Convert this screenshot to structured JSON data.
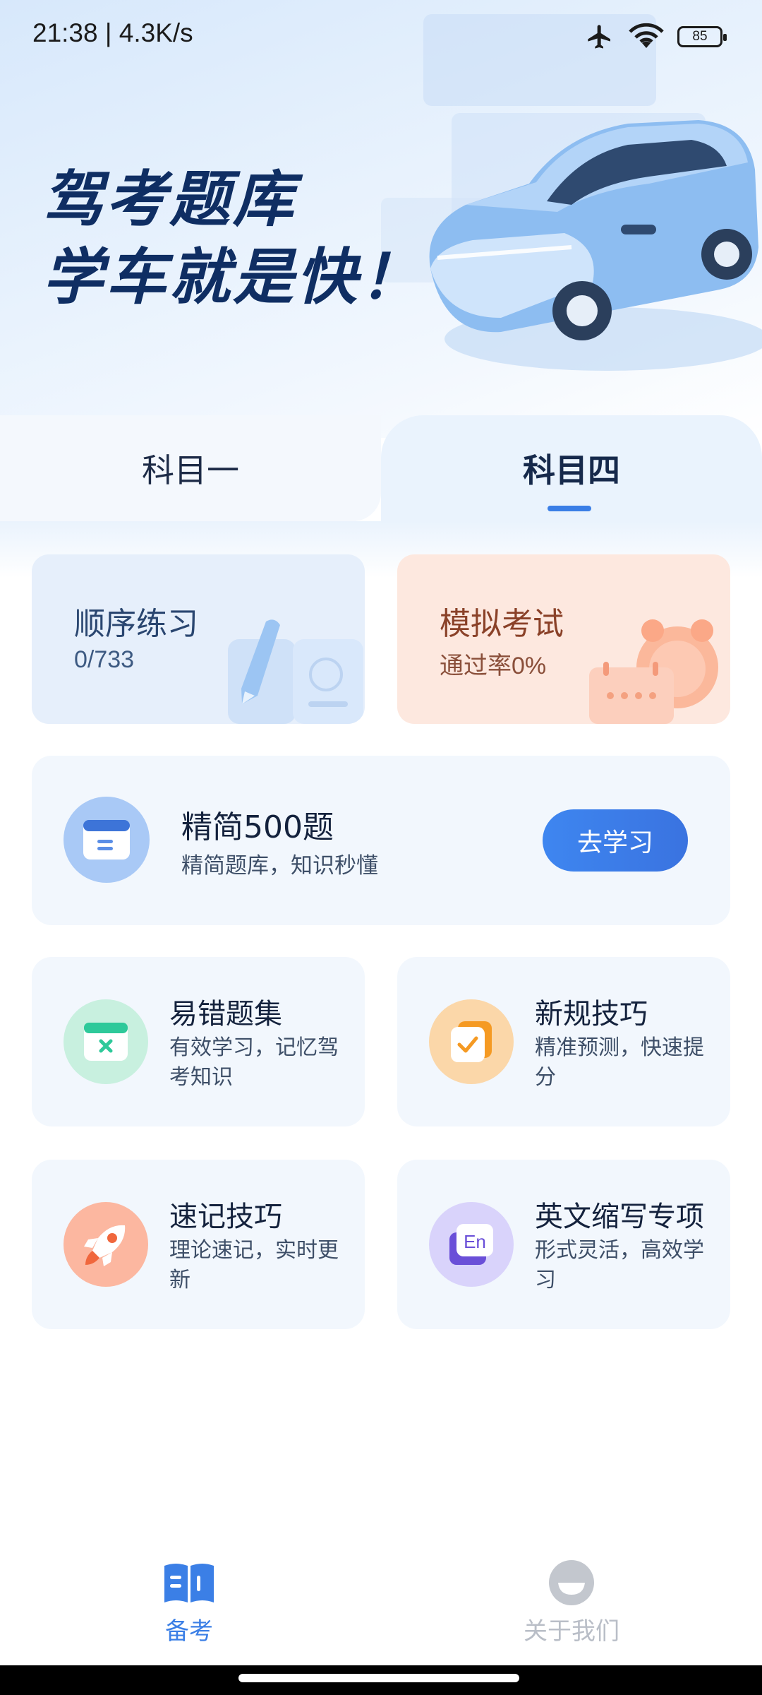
{
  "status_bar": {
    "time": "21:38 | 4.3K/s",
    "battery": "85"
  },
  "hero": {
    "title_line1": "驾考题库",
    "title_line2": "学车就是快！"
  },
  "tabs": [
    {
      "label": "科目一",
      "selected": false
    },
    {
      "label": "科目四",
      "selected": true
    }
  ],
  "quick_cards": {
    "sequential": {
      "title": "顺序练习",
      "progress": "0/733"
    },
    "mock_exam": {
      "title": "模拟考试",
      "pass_rate": "通过率0%"
    }
  },
  "banner": {
    "title": "精简500题",
    "subtitle": "精简题库，知识秒懂",
    "button_label": "去学习",
    "icon": "archive-box-icon"
  },
  "grid": [
    {
      "title": "易错题集",
      "subtitle": "有效学习，记忆驾考知识",
      "icon": "mistake-box-icon"
    },
    {
      "title": "新规技巧",
      "subtitle": "精准预测，快速提分",
      "icon": "checklist-icon"
    },
    {
      "title": "速记技巧",
      "subtitle": "理论速记，实时更新",
      "icon": "rocket-icon"
    },
    {
      "title": "英文缩写专项",
      "subtitle": "形式灵活，高效学习",
      "icon": "english-icon"
    }
  ],
  "bottom_nav": [
    {
      "label": "备考",
      "active": true,
      "icon": "book-icon"
    },
    {
      "label": "关于我们",
      "active": false,
      "icon": "user-icon"
    }
  ],
  "colors": {
    "accent": "#3b7fe6",
    "title_navy": "#0f2e63",
    "mock_card_bg": "#fde8df",
    "seq_card_bg": "#e6effb"
  }
}
